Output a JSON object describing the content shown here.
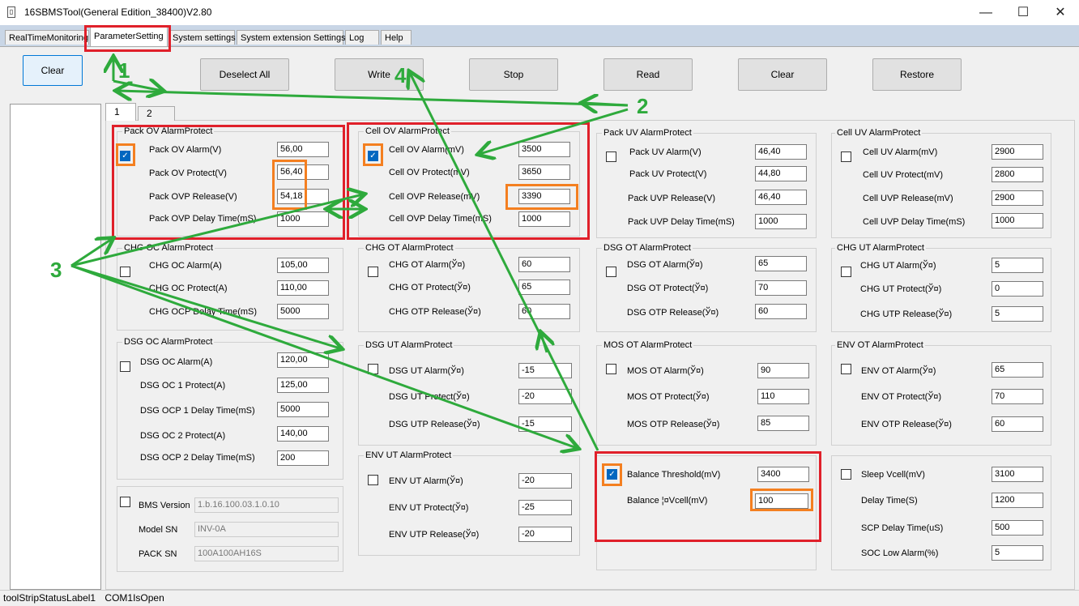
{
  "window": {
    "title": "16SBMSTool(General Edition_38400)V2.80",
    "icon": "battery-app-icon",
    "controls": {
      "minimize": "—",
      "maximize": "☐",
      "close": "✕"
    }
  },
  "menu_tabs": [
    {
      "label": "RealTimeMonitoring"
    },
    {
      "label": "ParameterSetting",
      "active": true
    },
    {
      "label": "System settings"
    },
    {
      "label": "System extension Settings"
    },
    {
      "label": "Log"
    },
    {
      "label": "Help"
    }
  ],
  "toolbar": {
    "clear_left": "Clear",
    "deselect_all": "Deselect All",
    "write": "Write",
    "stop": "Stop",
    "read": "Read",
    "clear": "Clear",
    "restore": "Restore"
  },
  "sub_tabs": [
    "1",
    "2"
  ],
  "groups": {
    "pack_ov": {
      "title": "Pack OV AlarmProtect",
      "checked": true,
      "rows": [
        {
          "label": "Pack OV Alarm(V)",
          "value": "56,00"
        },
        {
          "label": "Pack OV Protect(V)",
          "value": "56,40"
        },
        {
          "label": "Pack OVP Release(V)",
          "value": "54,18"
        },
        {
          "label": "Pack OVP Delay Time(mS)",
          "value": "1000"
        }
      ]
    },
    "cell_ov": {
      "title": "Cell OV AlarmProtect",
      "checked": true,
      "rows": [
        {
          "label": "Cell OV Alarm(mV)",
          "value": "3500"
        },
        {
          "label": "Cell OV Protect(mV)",
          "value": "3650"
        },
        {
          "label": "Cell OVP Release(mV)",
          "value": "3390"
        },
        {
          "label": "Cell OVP Delay Time(mS)",
          "value": "1000"
        }
      ]
    },
    "pack_uv": {
      "title": "Pack UV AlarmProtect",
      "checked": false,
      "rows": [
        {
          "label": "Pack UV Alarm(V)",
          "value": "46,40"
        },
        {
          "label": "Pack UV Protect(V)",
          "value": "44,80"
        },
        {
          "label": "Pack UVP Release(V)",
          "value": "46,40"
        },
        {
          "label": "Pack UVP Delay Time(mS)",
          "value": "1000"
        }
      ]
    },
    "cell_uv": {
      "title": "Cell UV AlarmProtect",
      "checked": false,
      "rows": [
        {
          "label": "Cell UV Alarm(mV)",
          "value": "2900"
        },
        {
          "label": "Cell UV Protect(mV)",
          "value": "2800"
        },
        {
          "label": "Cell UVP Release(mV)",
          "value": "2900"
        },
        {
          "label": "Cell UVP Delay Time(mS)",
          "value": "1000"
        }
      ]
    },
    "chg_oc": {
      "title": "CHG OC AlarmProtect",
      "checked": false,
      "rows": [
        {
          "label": "CHG OC Alarm(A)",
          "value": "105,00"
        },
        {
          "label": "CHG OC Protect(A)",
          "value": "110,00"
        },
        {
          "label": "CHG OCP Delay Time(mS)",
          "value": "5000"
        }
      ]
    },
    "chg_ot": {
      "title": "CHG OT AlarmProtect",
      "checked": false,
      "rows": [
        {
          "label": "CHG OT Alarm(Ў¤)",
          "value": "60"
        },
        {
          "label": "CHG OT Protect(Ў¤)",
          "value": "65"
        },
        {
          "label": "CHG OTP Release(Ў¤)",
          "value": "60"
        }
      ]
    },
    "dsg_ot": {
      "title": "DSG OT AlarmProtect",
      "checked": false,
      "rows": [
        {
          "label": "DSG OT Alarm(Ў¤)",
          "value": "65"
        },
        {
          "label": "DSG OT Protect(Ў¤)",
          "value": "70"
        },
        {
          "label": "DSG OTP Release(Ў¤)",
          "value": "60"
        }
      ]
    },
    "chg_ut": {
      "title": "CHG UT AlarmProtect",
      "checked": false,
      "rows": [
        {
          "label": "CHG UT Alarm(Ў¤)",
          "value": "5"
        },
        {
          "label": "CHG UT Protect(Ў¤)",
          "value": "0"
        },
        {
          "label": "CHG UTP Release(Ў¤)",
          "value": "5"
        }
      ]
    },
    "dsg_oc": {
      "title": "DSG OC AlarmProtect",
      "checked": false,
      "rows": [
        {
          "label": "DSG OC Alarm(A)",
          "value": "120,00"
        },
        {
          "label": "DSG OC 1 Protect(A)",
          "value": "125,00"
        },
        {
          "label": "DSG OCP 1 Delay Time(mS)",
          "value": "5000"
        },
        {
          "label": "DSG OC 2 Protect(A)",
          "value": "140,00"
        },
        {
          "label": "DSG OCP 2 Delay Time(mS)",
          "value": "200"
        }
      ]
    },
    "dsg_ut": {
      "title": "DSG UT AlarmProtect",
      "checked": false,
      "rows": [
        {
          "label": "DSG UT Alarm(Ў¤)",
          "value": "-15"
        },
        {
          "label": "DSG UT Protect(Ў¤)",
          "value": "-20"
        },
        {
          "label": "DSG UTP Release(Ў¤)",
          "value": "-15"
        }
      ]
    },
    "mos_ot": {
      "title": "MOS OT AlarmProtect",
      "checked": false,
      "rows": [
        {
          "label": "MOS OT Alarm(Ў¤)",
          "value": "90"
        },
        {
          "label": "MOS OT Protect(Ў¤)",
          "value": "110"
        },
        {
          "label": "MOS OTP Release(Ў¤)",
          "value": "85"
        }
      ]
    },
    "env_ot": {
      "title": "ENV OT AlarmProtect",
      "checked": false,
      "rows": [
        {
          "label": "ENV OT Alarm(Ў¤)",
          "value": "65"
        },
        {
          "label": "ENV OT Protect(Ў¤)",
          "value": "70"
        },
        {
          "label": "ENV OTP Release(Ў¤)",
          "value": "60"
        }
      ]
    },
    "env_ut": {
      "title": "ENV UT AlarmProtect",
      "checked": false,
      "rows": [
        {
          "label": "ENV UT Alarm(Ў¤)",
          "value": "-20"
        },
        {
          "label": "ENV UT Protect(Ў¤)",
          "value": "-25"
        },
        {
          "label": "ENV UTP Release(Ў¤)",
          "value": "-20"
        }
      ]
    },
    "balance": {
      "checked": true,
      "rows": [
        {
          "label": "Balance Threshold(mV)",
          "value": "3400"
        },
        {
          "label": "Balance ¦¤Vcell(mV)",
          "value": "100"
        }
      ]
    },
    "sleep": {
      "checked": false,
      "rows": [
        {
          "label": "Sleep Vcell(mV)",
          "value": "3100"
        },
        {
          "label": "Delay Time(S)",
          "value": "1200"
        },
        {
          "label": "SCP Delay Time(uS)",
          "value": "500"
        },
        {
          "label": "SOC Low Alarm(%)",
          "value": "5"
        }
      ]
    },
    "bms_info": {
      "checked": false,
      "rows": [
        {
          "label": "BMS Version",
          "value": "1.b.16.100.03.1.0.10"
        },
        {
          "label": "Model SN",
          "value": "INV-0A"
        },
        {
          "label": "PACK SN",
          "value": "100A100AH16S"
        }
      ]
    }
  },
  "status_bar": {
    "label": "toolStripStatusLabel1",
    "port": "COM1IsOpen"
  },
  "annotations": {
    "numbers": [
      "1",
      "2",
      "3",
      "4"
    ],
    "arrow_color": "#2eaa3c",
    "box_color": "#e0202a",
    "highlight_color": "#f47f20"
  }
}
